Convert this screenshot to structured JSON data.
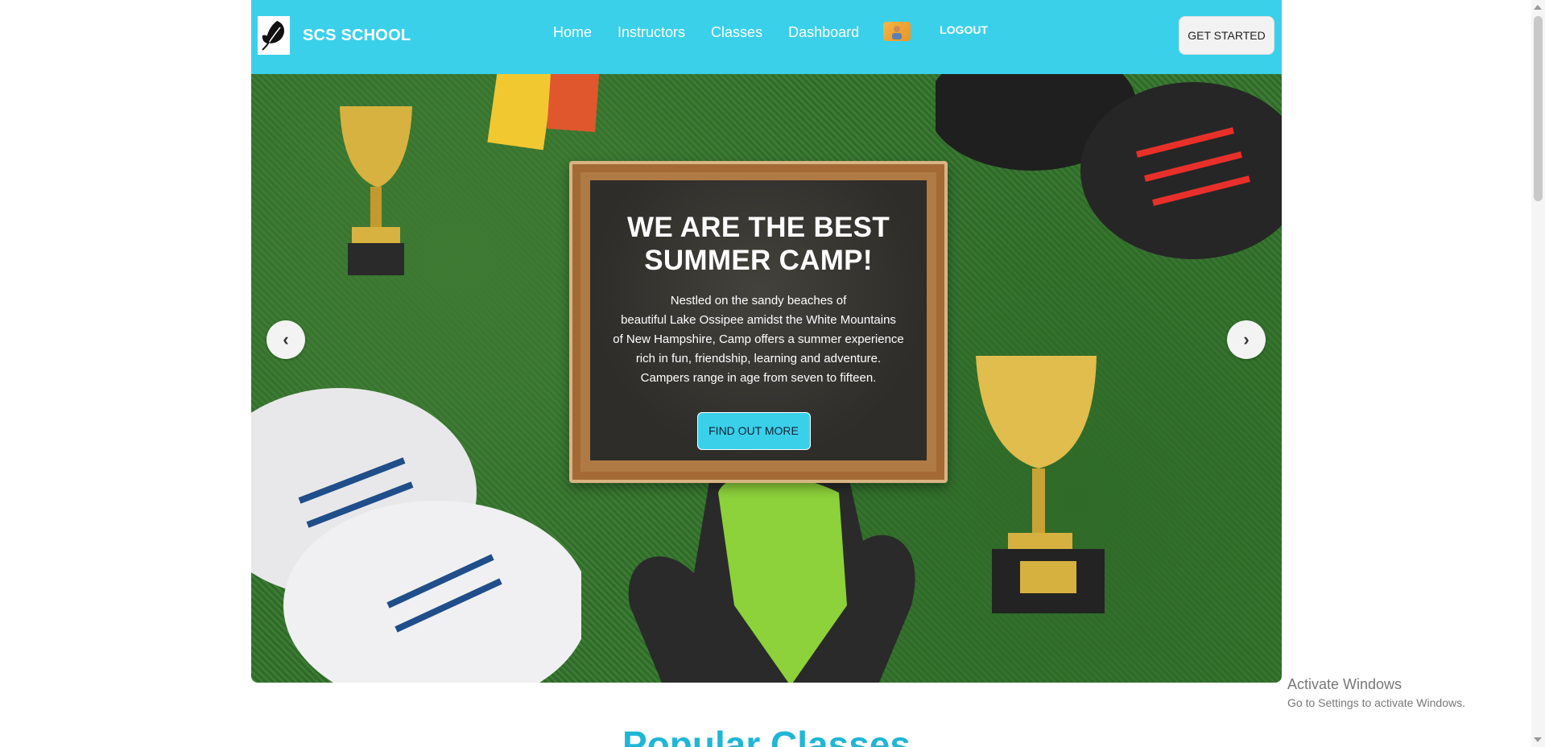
{
  "header": {
    "brand": "SCS SCHOOL",
    "nav": [
      "Home",
      "Instructors",
      "Classes",
      "Dashboard"
    ],
    "logout": "LOGOUT",
    "cta": "GET STARTED"
  },
  "hero": {
    "title_line1": "WE ARE THE BEST",
    "title_line2": "SUMMER CAMP!",
    "text_lines": [
      "Nestled on the sandy beaches of",
      "beautiful Lake Ossipee amidst the White Mountains",
      "of New Hampshire, Camp offers a summer experience",
      "rich in fun, friendship, learning and adventure.",
      "Campers range in age from seven to fifteen."
    ],
    "button": "FIND OUT MORE",
    "prev": "‹",
    "next": "›"
  },
  "section": {
    "title": "Popular Classes"
  },
  "watermark": {
    "title": "Activate Windows",
    "subtitle": "Go to Settings to activate Windows."
  },
  "colors": {
    "accent": "#3ad0ea",
    "heading": "#20b6d6"
  }
}
